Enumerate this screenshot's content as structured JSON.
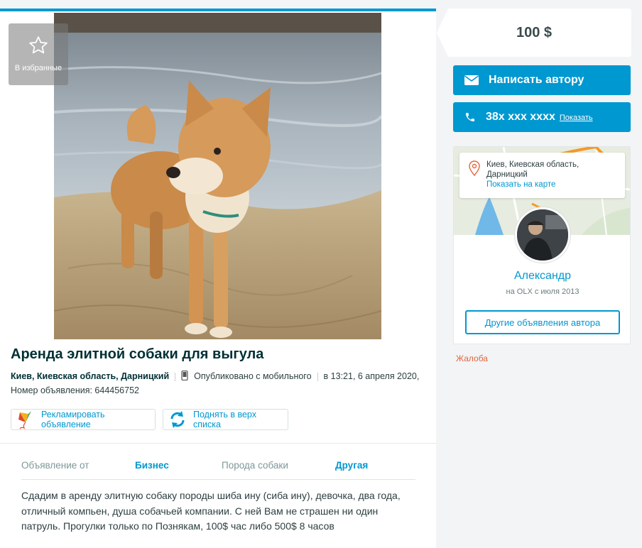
{
  "ad": {
    "favorite_label": "В избранные",
    "title": "Аренда элитной собаки для выгула",
    "location": "Киев, Киевская область, Дарницкий",
    "published_via": "Опубликовано с мобильного",
    "published_at": "в 13:21, 6 апреля 2020,",
    "ad_number": "Номер объявления: 644456752",
    "promote_label": "Рекламировать объявление",
    "raise_label": "Поднять в верх списка",
    "params": [
      {
        "key": "Объявление от",
        "value": "Бизнес"
      },
      {
        "key": "Порода собаки",
        "value": "Другая"
      }
    ],
    "description": "Сдадим в аренду элитную собаку породы шиба ину (сиба ину), девочка, два года, отличный компьен, душа собачьей компании. С ней Вам не страшен ни один патруль. Прогулки только по Познякам, 100$ час либо 500$ 8 часов"
  },
  "sidebar": {
    "price": "100 $",
    "message_label": "Написать автору",
    "phone_masked": "38x xxx xxxx",
    "phone_show": "Показать",
    "location_line1": "Киев, Киевская область,",
    "location_line2": "Дарницкий",
    "map_link": "Показать на карте",
    "seller_name": "Александр",
    "seller_since": "на OLX с июля 2013",
    "other_ads_label": "Другие объявления автора",
    "report_label": "Жалоба"
  },
  "colors": {
    "accent": "#0098d0",
    "report": "#e4653d"
  }
}
